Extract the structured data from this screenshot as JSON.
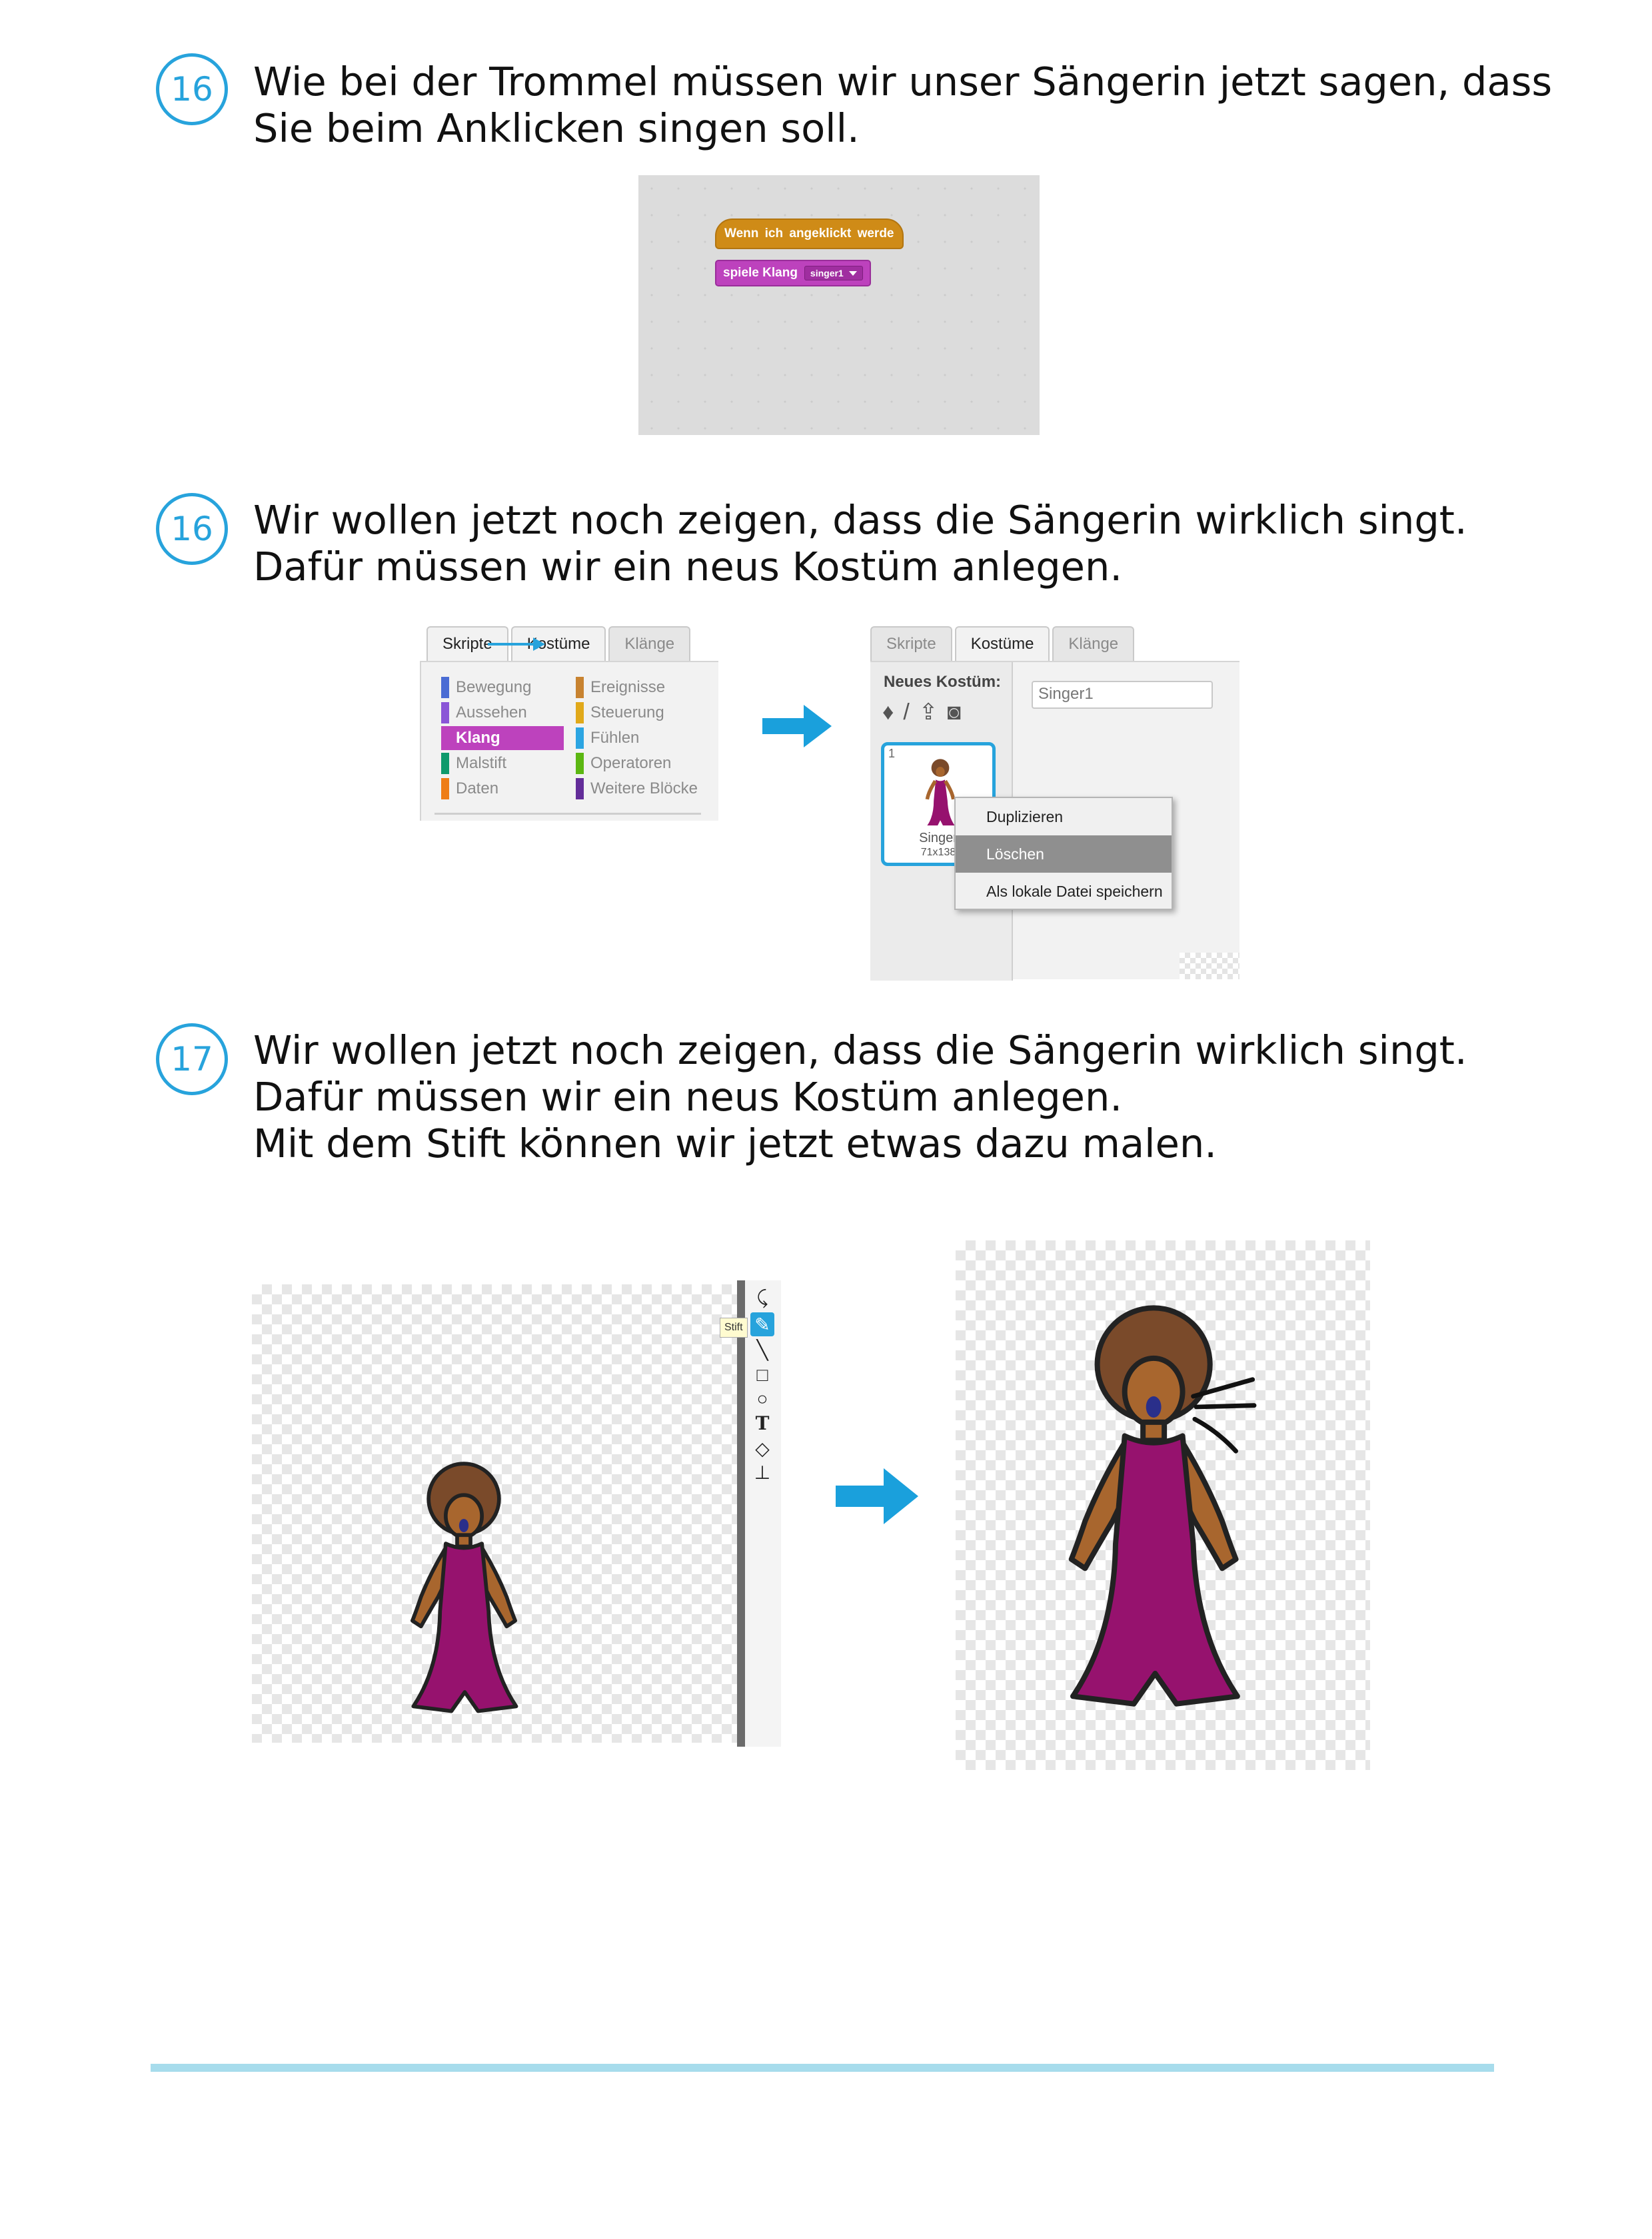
{
  "steps": [
    {
      "number": "16",
      "lines": [
        "Wie bei der Trommel müssen wir unser Sängerin jetzt sagen, dass",
        "Sie beim Anklicken singen soll."
      ]
    },
    {
      "number": "16",
      "lines": [
        "Wir wollen jetzt noch zeigen, dass die Sängerin wirklich singt.",
        "Dafür müssen wir ein neus Kostüm anlegen."
      ]
    },
    {
      "number": "17",
      "lines": [
        "Wir wollen jetzt noch zeigen, dass die Sängerin wirklich singt.",
        "Dafür müssen wir ein neus Kostüm anlegen.",
        "Mit dem Stift können wir jetzt etwas dazu malen."
      ]
    }
  ],
  "script": {
    "hat_block": "Wenn ich angeklickt werde",
    "sound_block": "spiele Klang",
    "sound_value": "singer1"
  },
  "tabs_panel": {
    "tabs": [
      "Skripte",
      "Kostüme",
      "Klänge"
    ],
    "categories_left": [
      "Bewegung",
      "Aussehen",
      "Klang",
      "Malstift",
      "Daten"
    ],
    "categories_right": [
      "Ereignisse",
      "Steuerung",
      "Fühlen",
      "Operatoren",
      "Weitere Blöcke"
    ],
    "selected_category": "Klang",
    "colors": {
      "Bewegung": "#4a6cd4",
      "Aussehen": "#8a55d7",
      "Klang": "#bb42c3",
      "Malstift": "#0e9a6c",
      "Daten": "#ee7d16",
      "Ereignisse": "#c88330",
      "Steuerung": "#e1a91a",
      "Fühlen": "#2ca5e2",
      "Operatoren": "#5cb712",
      "Weitere Blöcke": "#632d99"
    }
  },
  "costume_panel": {
    "tabs": [
      "Skripte",
      "Kostüme",
      "Klänge"
    ],
    "active_tab": "Kostüme",
    "new_costume_label": "Neues Kostüm:",
    "tool_icons": [
      "sprite-library-icon",
      "paint-brush-icon",
      "upload-icon",
      "camera-icon"
    ],
    "costume_name": "Singer1",
    "thumbnail": {
      "index": "1",
      "name": "Singer",
      "size": "71x138"
    },
    "context_menu": [
      "Duplizieren",
      "Löschen",
      "Als lokale Datei speichern"
    ],
    "highlighted_menu_item": "Löschen"
  },
  "paint_editor": {
    "tooltip": "Stift",
    "tools": [
      "reshape-icon",
      "pencil-icon",
      "line-icon",
      "rectangle-icon",
      "ellipse-icon",
      "text-icon",
      "fill-icon",
      "stamp-icon"
    ],
    "selected_tool": "pencil-icon"
  },
  "colors": {
    "accent": "#27a3dc",
    "arrow": "#1aa0dc",
    "footer_rule": "#a7dcec",
    "dress": "#96126e",
    "hair": "#7a4a2a",
    "skin": "#a8662e"
  }
}
